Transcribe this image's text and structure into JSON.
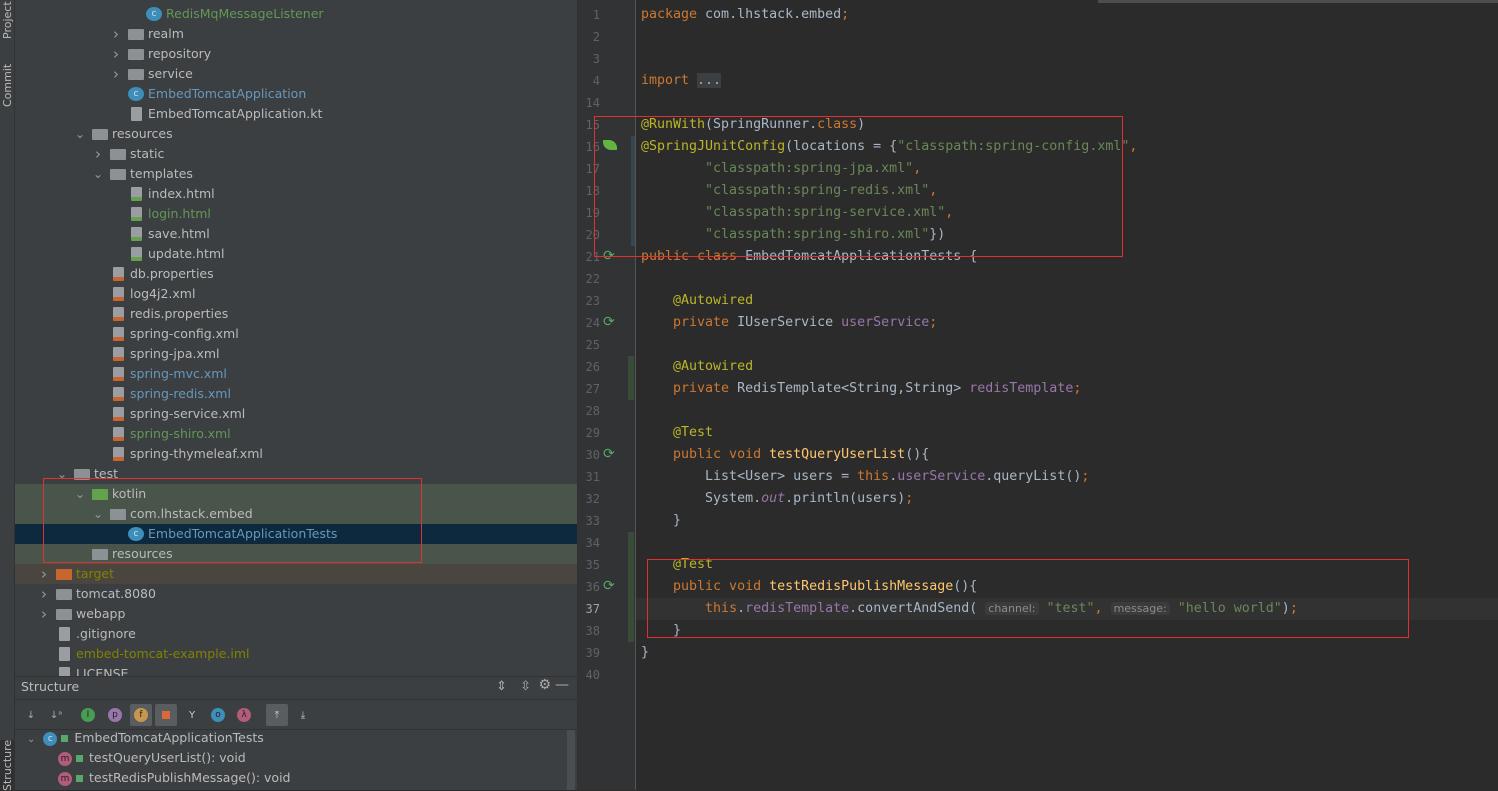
{
  "left_strip": {
    "tabs": [
      "Project",
      "Commit",
      "Structure"
    ]
  },
  "project_tree": [
    {
      "depth": 5,
      "icon": "class",
      "label": "RedisMqMessageListener",
      "color": "#629755"
    },
    {
      "depth": 4,
      "arrow": "right",
      "icon": "package",
      "label": "realm"
    },
    {
      "depth": 4,
      "arrow": "right",
      "icon": "package",
      "label": "repository"
    },
    {
      "depth": 4,
      "arrow": "right",
      "icon": "package",
      "label": "service"
    },
    {
      "depth": 4,
      "icon": "class-run",
      "label": "EmbedTomcatApplication",
      "color": "#6897bb"
    },
    {
      "depth": 4,
      "icon": "kotlin-file",
      "label": "EmbedTomcatApplication.kt"
    },
    {
      "depth": 2,
      "arrow": "down",
      "icon": "resources-folder",
      "label": "resources"
    },
    {
      "depth": 3,
      "arrow": "right",
      "icon": "folder",
      "label": "static"
    },
    {
      "depth": 3,
      "arrow": "down",
      "icon": "folder",
      "label": "templates"
    },
    {
      "depth": 4,
      "icon": "html-file",
      "label": "index.html"
    },
    {
      "depth": 4,
      "icon": "html-file",
      "label": "login.html",
      "color": "#629755"
    },
    {
      "depth": 4,
      "icon": "html-file",
      "label": "save.html"
    },
    {
      "depth": 4,
      "icon": "html-file",
      "label": "update.html"
    },
    {
      "depth": 3,
      "icon": "properties-file",
      "label": "db.properties"
    },
    {
      "depth": 3,
      "icon": "xml-file",
      "label": "log4j2.xml"
    },
    {
      "depth": 3,
      "icon": "properties-file",
      "label": "redis.properties"
    },
    {
      "depth": 3,
      "icon": "xml-file",
      "label": "spring-config.xml"
    },
    {
      "depth": 3,
      "icon": "xml-file",
      "label": "spring-jpa.xml"
    },
    {
      "depth": 3,
      "icon": "xml-file",
      "label": "spring-mvc.xml",
      "color": "#6897bb"
    },
    {
      "depth": 3,
      "icon": "xml-file",
      "label": "spring-redis.xml",
      "color": "#6897bb"
    },
    {
      "depth": 3,
      "icon": "xml-file",
      "label": "spring-service.xml"
    },
    {
      "depth": 3,
      "icon": "xml-file",
      "label": "spring-shiro.xml",
      "color": "#629755"
    },
    {
      "depth": 3,
      "icon": "xml-file",
      "label": "spring-thymeleaf.xml"
    },
    {
      "depth": 1,
      "arrow": "down",
      "icon": "folder",
      "label": "test"
    },
    {
      "depth": 2,
      "arrow": "down",
      "icon": "test-folder",
      "label": "kotlin",
      "bg": "#49544a"
    },
    {
      "depth": 3,
      "arrow": "down",
      "icon": "package",
      "label": "com.lhstack.embed",
      "bg": "#49544a"
    },
    {
      "depth": 4,
      "icon": "class-test",
      "label": "EmbedTomcatApplicationTests",
      "color": "#6897bb",
      "bg": "#0d293e",
      "selected": true
    },
    {
      "depth": 2,
      "icon": "test-resources-folder",
      "label": "resources",
      "bg": "#49544a"
    },
    {
      "depth": 0,
      "arrow": "right",
      "icon": "excluded-folder",
      "label": "target",
      "color": "#828200",
      "bg": "#4a463f"
    },
    {
      "depth": 0,
      "arrow": "right",
      "icon": "folder",
      "label": "tomcat.8080"
    },
    {
      "depth": 0,
      "arrow": "right",
      "icon": "folder",
      "label": "webapp"
    },
    {
      "depth": 0,
      "icon": "gitignore-file",
      "label": ".gitignore"
    },
    {
      "depth": 0,
      "icon": "iml-file",
      "label": "embed-tomcat-example.iml",
      "color": "#828200"
    },
    {
      "depth": 0,
      "icon": "text-file",
      "label": "LICENSE"
    }
  ],
  "structure": {
    "title": "Structure",
    "root": "EmbedTomcatApplicationTests",
    "members": [
      "testQueryUserList(): void",
      "testRedisPublishMessage(): void"
    ]
  },
  "editor": {
    "lines": [
      {
        "n": "1",
        "t": [
          [
            "package ",
            "kw"
          ],
          [
            "com.lhstack.embed",
            ""
          ],
          [
            ";",
            "kw"
          ]
        ]
      },
      {
        "n": "2",
        "t": []
      },
      {
        "n": "3",
        "t": []
      },
      {
        "n": "4",
        "t": [
          [
            "import ",
            "kw"
          ],
          [
            "...",
            "fold"
          ]
        ]
      },
      {
        "n": "14",
        "t": []
      },
      {
        "n": "15",
        "t": [
          [
            "@RunWith",
            "an"
          ],
          [
            "(SpringRunner.",
            ""
          ],
          [
            "class",
            "kw"
          ],
          [
            ")",
            ""
          ]
        ]
      },
      {
        "n": "16",
        "t": [
          [
            "@SpringJUnitConfig",
            "an"
          ],
          [
            "(locations = {",
            ""
          ],
          [
            "\"classpath:spring-config.xml\"",
            "st"
          ],
          [
            ",",
            "kw"
          ]
        ]
      },
      {
        "n": "17",
        "t": [
          [
            "        \"classpath:spring-jpa.xml\"",
            "st"
          ],
          [
            ",",
            "kw"
          ]
        ]
      },
      {
        "n": "18",
        "t": [
          [
            "        \"classpath:spring-redis.xml\"",
            "st"
          ],
          [
            ",",
            "kw"
          ]
        ]
      },
      {
        "n": "19",
        "t": [
          [
            "        \"classpath:spring-service.xml\"",
            "st"
          ],
          [
            ",",
            "kw"
          ]
        ]
      },
      {
        "n": "20",
        "t": [
          [
            "        \"classpath:spring-shiro.xml\"",
            "st"
          ],
          [
            "})",
            ""
          ]
        ]
      },
      {
        "n": "21",
        "t": [
          [
            "public class ",
            "kw"
          ],
          [
            "EmbedTomcatApplicationTests {",
            ""
          ]
        ]
      },
      {
        "n": "22",
        "t": []
      },
      {
        "n": "23",
        "t": [
          [
            "    @Autowired",
            "an"
          ]
        ]
      },
      {
        "n": "24",
        "t": [
          [
            "    private ",
            "kw"
          ],
          [
            "IUserService ",
            ""
          ],
          [
            "userService",
            "fd"
          ],
          [
            ";",
            "kw"
          ]
        ]
      },
      {
        "n": "25",
        "t": []
      },
      {
        "n": "26",
        "t": [
          [
            "    @Autowired",
            "an"
          ]
        ]
      },
      {
        "n": "27",
        "t": [
          [
            "    private ",
            "kw"
          ],
          [
            "RedisTemplate<String,String> ",
            ""
          ],
          [
            "redisTemplate",
            "fd"
          ],
          [
            ";",
            "kw"
          ]
        ]
      },
      {
        "n": "28",
        "t": []
      },
      {
        "n": "29",
        "t": [
          [
            "    @Test",
            "an"
          ]
        ]
      },
      {
        "n": "30",
        "t": [
          [
            "    public void ",
            "kw"
          ],
          [
            "testQueryUserList",
            "fn"
          ],
          [
            "(){",
            ""
          ]
        ]
      },
      {
        "n": "31",
        "t": [
          [
            "        List<User> users = ",
            ""
          ],
          [
            "this",
            "kw"
          ],
          [
            ".",
            ""
          ],
          [
            "userService",
            "fd"
          ],
          [
            ".queryList()",
            ""
          ],
          [
            ";",
            "kw"
          ]
        ]
      },
      {
        "n": "32",
        "t": [
          [
            "        System.",
            ""
          ],
          [
            "out",
            "it"
          ],
          [
            ".println(users)",
            ""
          ],
          [
            ";",
            "kw"
          ]
        ]
      },
      {
        "n": "33",
        "t": [
          [
            "    }",
            ""
          ]
        ]
      },
      {
        "n": "34",
        "t": []
      },
      {
        "n": "35",
        "t": [
          [
            "    @Test",
            "an"
          ]
        ]
      },
      {
        "n": "36",
        "t": [
          [
            "    public void ",
            "kw"
          ],
          [
            "testRedisPublishMessage",
            "fn"
          ],
          [
            "(){",
            ""
          ]
        ]
      },
      {
        "n": "37",
        "t": [
          [
            "        ",
            ""
          ],
          [
            "this",
            "kw"
          ],
          [
            ".",
            ""
          ],
          [
            "redisTemplate",
            "fd"
          ],
          [
            ".convertAndSend( ",
            ""
          ],
          [
            "channel:",
            "hint"
          ],
          [
            " \"test\"",
            "st"
          ],
          [
            ", ",
            "kw"
          ],
          [
            "message:",
            "hint"
          ],
          [
            " \"hello world\"",
            "st"
          ],
          [
            ")",
            ""
          ],
          [
            ";",
            "kw"
          ]
        ]
      },
      {
        "n": "38",
        "t": [
          [
            "    }",
            ""
          ]
        ]
      },
      {
        "n": "39",
        "t": [
          [
            "}",
            ""
          ]
        ]
      },
      {
        "n": "40",
        "t": []
      }
    ],
    "current_line": "37"
  },
  "colors": {
    "annotation_box": "#e03030",
    "selection": "#0d293e"
  }
}
